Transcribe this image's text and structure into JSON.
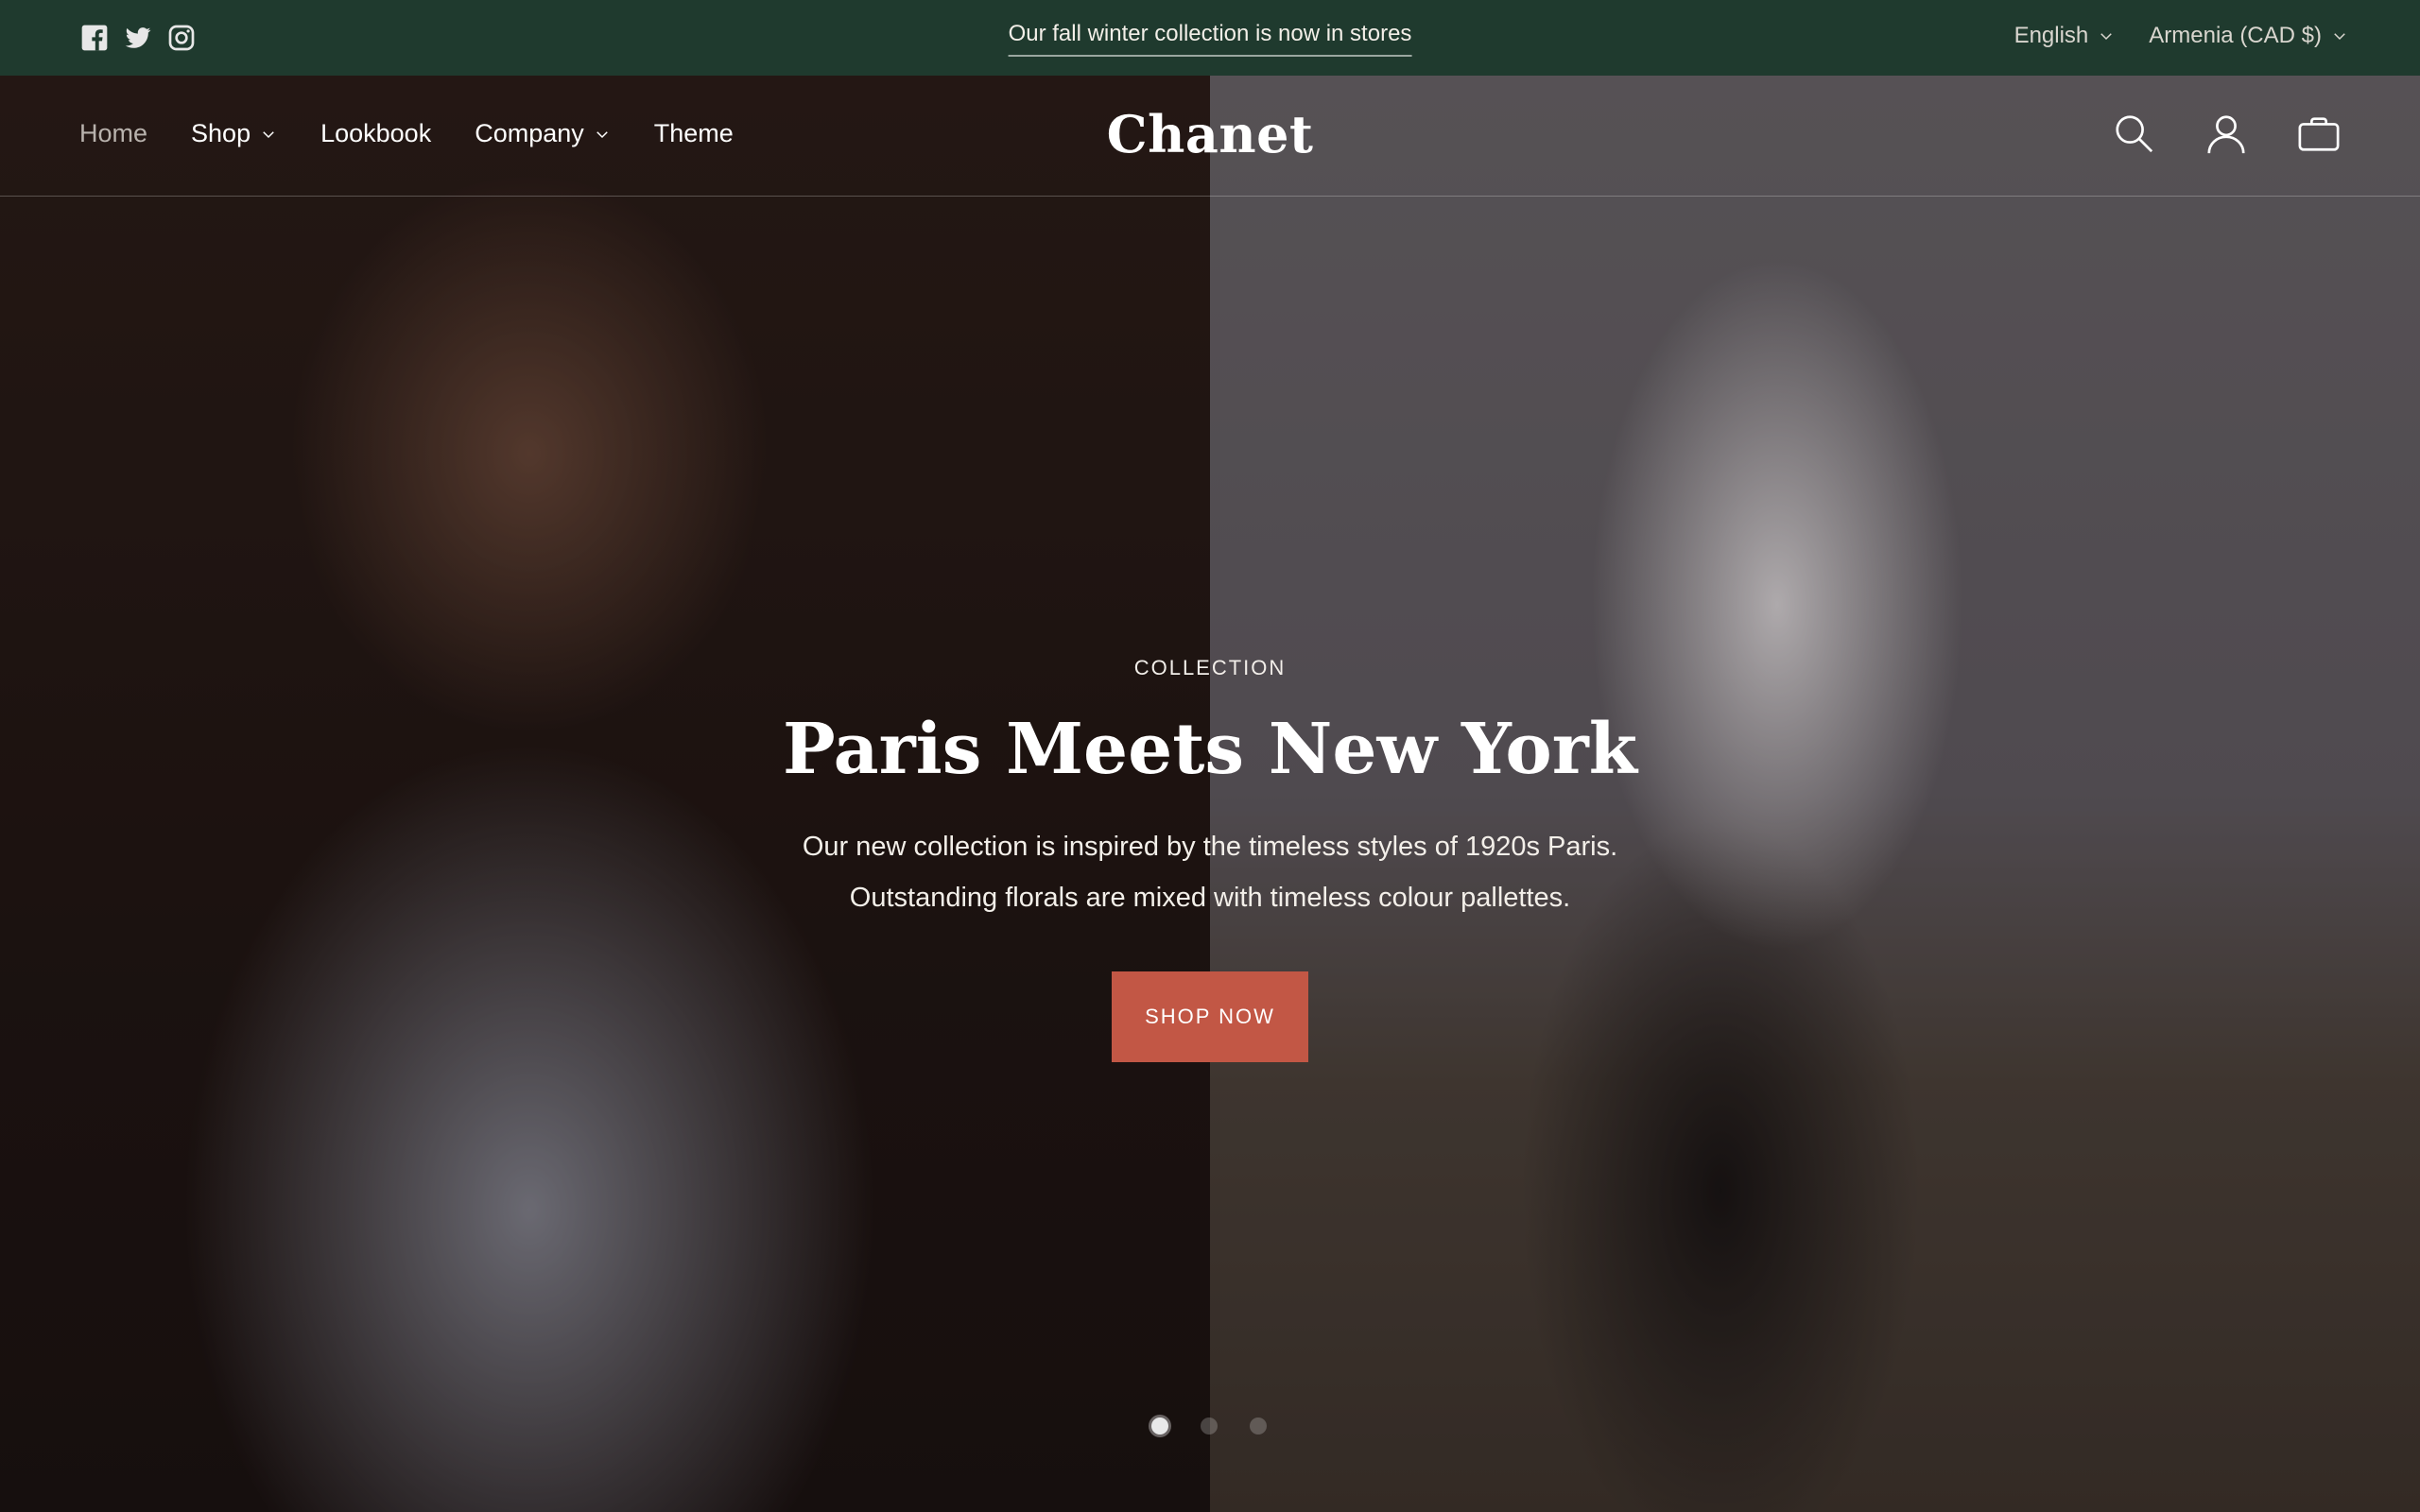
{
  "announcement": {
    "text": "Our fall winter collection is now in stores",
    "social_icons": [
      "facebook-icon",
      "twitter-icon",
      "instagram-icon"
    ],
    "language": "English",
    "currency": "Armenia (CAD $)"
  },
  "header": {
    "logo": "Chanet",
    "nav": [
      {
        "label": "Home",
        "active": true,
        "has_dropdown": false
      },
      {
        "label": "Shop",
        "active": false,
        "has_dropdown": true
      },
      {
        "label": "Lookbook",
        "active": false,
        "has_dropdown": false
      },
      {
        "label": "Company",
        "active": false,
        "has_dropdown": true
      },
      {
        "label": "Theme",
        "active": false,
        "has_dropdown": false
      }
    ],
    "icons": [
      "search-icon",
      "account-icon",
      "cart-icon"
    ]
  },
  "hero": {
    "eyebrow": "COLLECTION",
    "title": "Paris Meets New York",
    "line1": "Our new collection is inspired by the timeless styles of 1920s Paris.",
    "line2": "Outstanding florals are mixed with timeless colour pallettes.",
    "cta": "SHOP NOW",
    "slides_total": 3,
    "active_slide": 1
  },
  "colors": {
    "announcement_bg": "#1f3a2e",
    "cta_bg": "#c25745"
  }
}
